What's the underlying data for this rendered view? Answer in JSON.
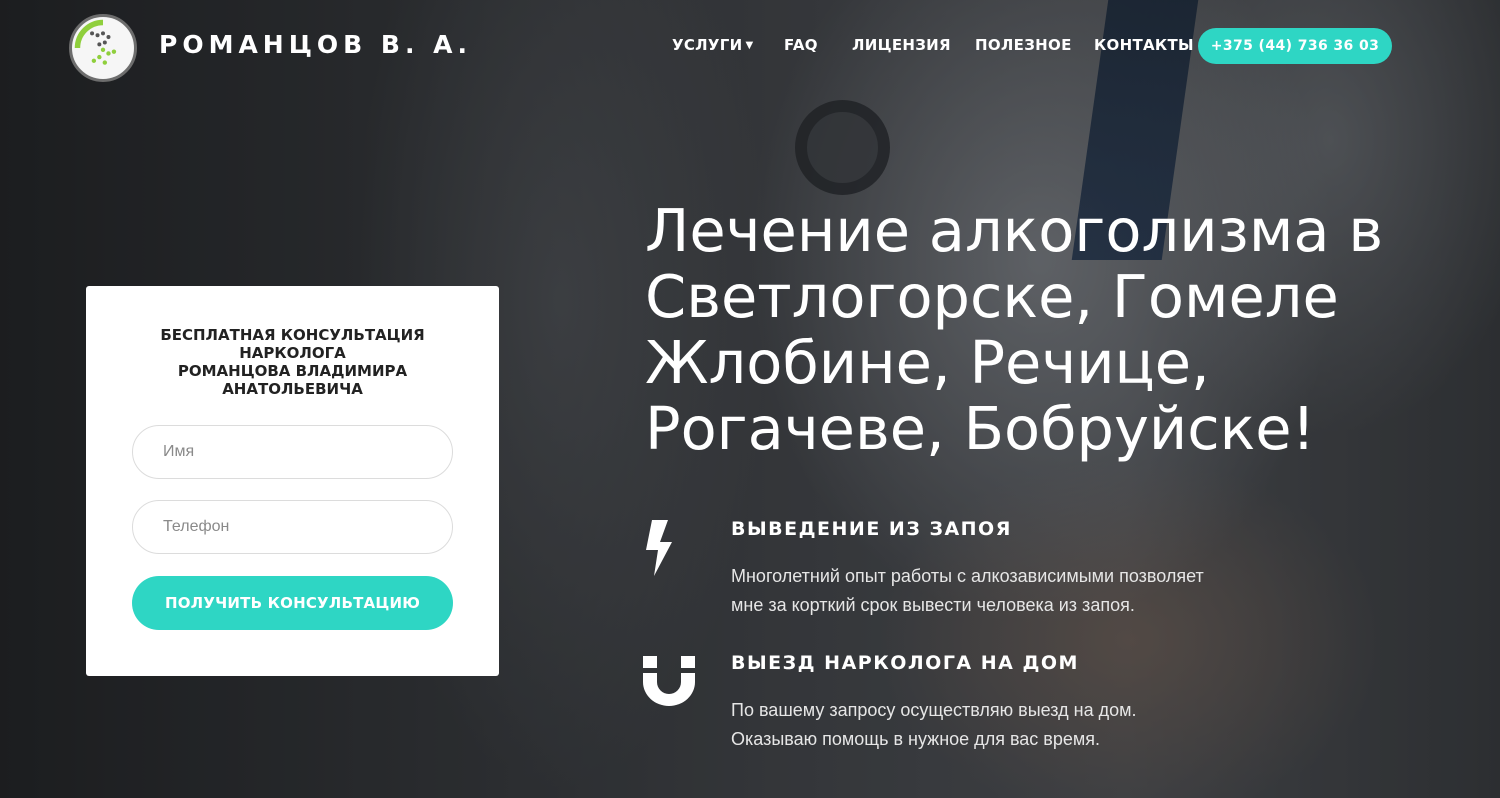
{
  "header": {
    "brand": "РОМАНЦОВ В. А.",
    "nav": [
      {
        "label": "УСЛУГИ",
        "has_dropdown": true
      },
      {
        "label": "FAQ"
      },
      {
        "label": "ЛИЦЕНЗИЯ"
      },
      {
        "label": "ПОЛЕЗНОЕ"
      },
      {
        "label": "КОНТАКТЫ"
      }
    ],
    "phone": "+375 (44) 736 36 03"
  },
  "form": {
    "title_lines": [
      "БЕСПЛАТНАЯ КОНСУЛЬТАЦИЯ",
      "НАРКОЛОГА",
      "РОМАНЦОВА ВЛАДИМИРА",
      "АНАТОЛЬЕВИЧА"
    ],
    "name_placeholder": "Имя",
    "phone_placeholder": "Телефон",
    "submit_label": "ПОЛУЧИТЬ КОНСУЛЬТАЦИЮ"
  },
  "hero": {
    "title_lines": [
      "Лечение алкоголизма в",
      "Светлогорске, Гомеле",
      "Жлобине, Речице,",
      "Рогачеве, Бобруйске!"
    ]
  },
  "features": [
    {
      "icon": "lightning-icon",
      "title": "ВЫВЕДЕНИЕ ИЗ ЗАПОЯ",
      "text_lines": [
        "Многолетний опыт работы с алкозависимыми позволяет",
        "мне за корткий срок вывести человека из запоя."
      ]
    },
    {
      "icon": "magnet-icon",
      "title": "ВЫЕЗД НАРКОЛОГА НА ДОМ",
      "text_lines": [
        "По вашему запросу осуществляю выезд на дом.",
        "Оказываю помощь в нужное для вас время."
      ]
    }
  ],
  "colors": {
    "accent": "#2ed6c4",
    "card_bg": "#ffffff"
  }
}
